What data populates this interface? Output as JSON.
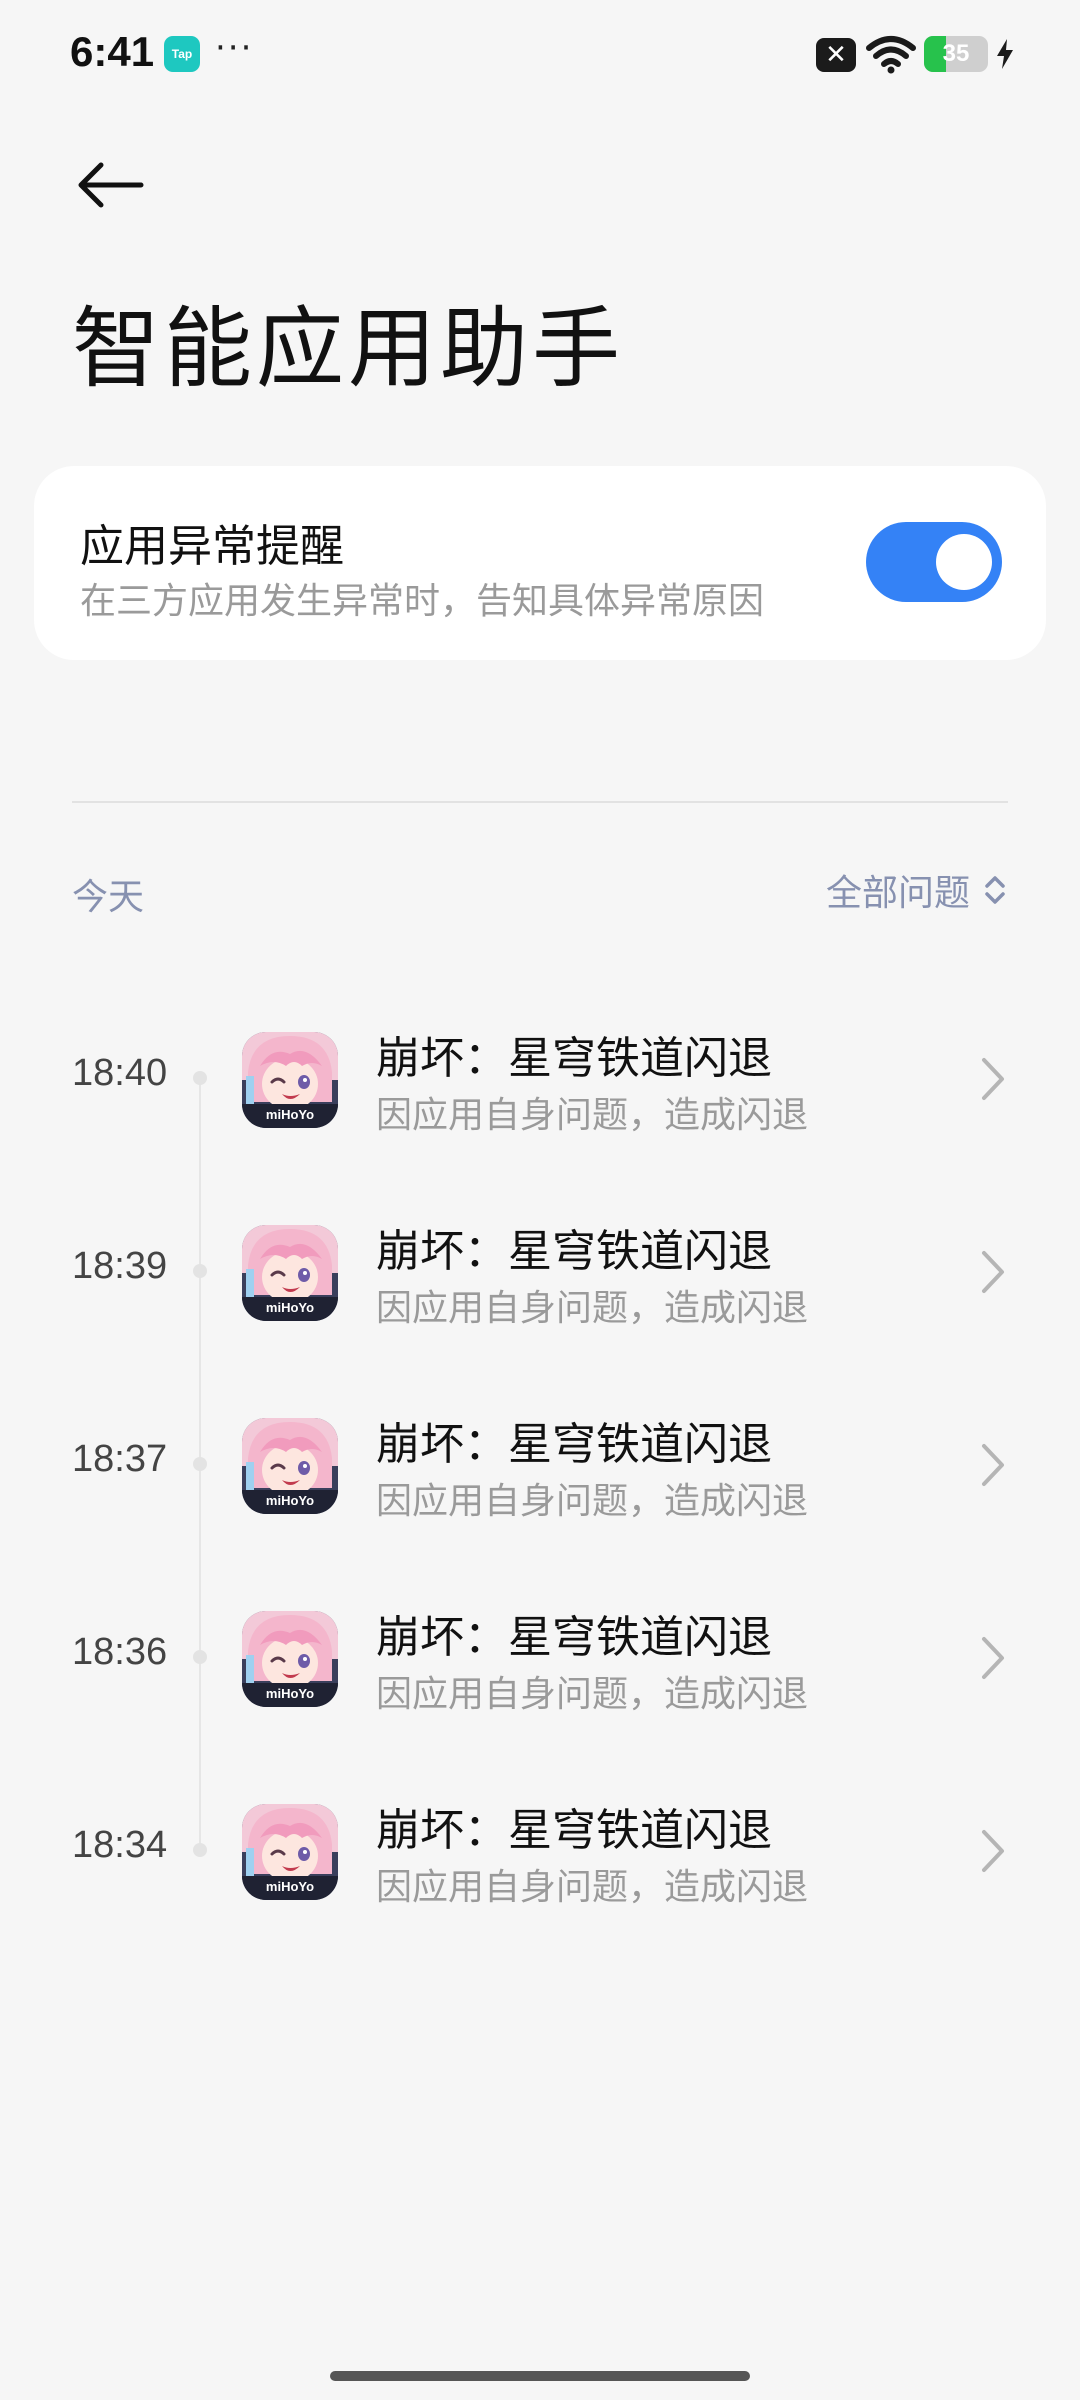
{
  "status_bar": {
    "time": "6:41",
    "app_badge": "Tap",
    "more": "···",
    "notification_icon": "close-square-icon",
    "wifi_icon": "wifi-icon",
    "battery_level": "35",
    "battery_fraction": 0.35,
    "charging_icon": "bolt-icon"
  },
  "header": {
    "back_icon": "arrow-left-icon",
    "title": "智能应用助手"
  },
  "settings_card": {
    "title": "应用异常提醒",
    "description": "在三方应用发生异常时，告知具体异常原因",
    "toggle_on": true,
    "toggle_color": "#3482f6"
  },
  "list_header": {
    "day_label": "今天",
    "filter_label": "全部问题",
    "filter_icon": "up-down-chevron-icon"
  },
  "entries": [
    {
      "time": "18:40",
      "title": "崩坏：星穹铁道闪退",
      "reason": "因应用自身问题，造成闪退"
    },
    {
      "time": "18:39",
      "title": "崩坏：星穹铁道闪退",
      "reason": "因应用自身问题，造成闪退"
    },
    {
      "time": "18:37",
      "title": "崩坏：星穹铁道闪退",
      "reason": "因应用自身问题，造成闪退"
    },
    {
      "time": "18:36",
      "title": "崩坏：星穹铁道闪退",
      "reason": "因应用自身问题，造成闪退"
    },
    {
      "time": "18:34",
      "title": "崩坏：星穹铁道闪退",
      "reason": "因应用自身问题，造成闪退"
    }
  ],
  "app_icon_badge": "miHoYo"
}
